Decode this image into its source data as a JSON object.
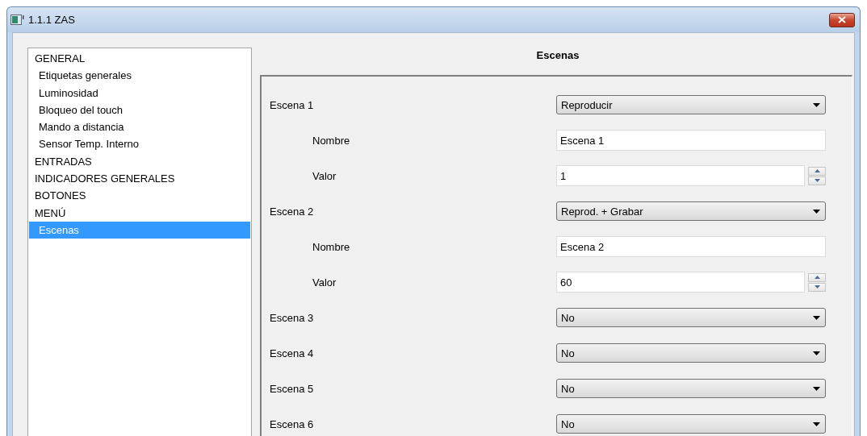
{
  "window": {
    "title": "1.1.1 ZAS"
  },
  "sidebar": {
    "items": [
      {
        "label": "GENERAL",
        "selected": false,
        "children": [
          {
            "label": "Etiquetas generales",
            "selected": false
          },
          {
            "label": "Luminosidad",
            "selected": false
          },
          {
            "label": "Bloqueo del touch",
            "selected": false
          },
          {
            "label": "Mando a distancia",
            "selected": false
          },
          {
            "label": "Sensor Temp. Interno",
            "selected": false
          }
        ]
      },
      {
        "label": "ENTRADAS",
        "selected": false
      },
      {
        "label": "INDICADORES GENERALES",
        "selected": false
      },
      {
        "label": "BOTONES",
        "selected": false
      },
      {
        "label": "MENÚ",
        "selected": false,
        "children": [
          {
            "label": "Escenas",
            "selected": true
          }
        ]
      }
    ]
  },
  "panel": {
    "title": "Escenas",
    "rows": [
      {
        "label": "Escena 1",
        "kind": "select",
        "value": "Reproducir",
        "children": [
          {
            "label": "Nombre",
            "kind": "text",
            "value": "Escena 1"
          },
          {
            "label": "Valor",
            "kind": "spin",
            "value": "1"
          }
        ]
      },
      {
        "label": "Escena 2",
        "kind": "select",
        "value": "Reprod. + Grabar",
        "children": [
          {
            "label": "Nombre",
            "kind": "text",
            "value": "Escena 2"
          },
          {
            "label": "Valor",
            "kind": "spin",
            "value": "60"
          }
        ]
      },
      {
        "label": "Escena 3",
        "kind": "select",
        "value": "No"
      },
      {
        "label": "Escena 4",
        "kind": "select",
        "value": "No"
      },
      {
        "label": "Escena 5",
        "kind": "select",
        "value": "No"
      },
      {
        "label": "Escena 6",
        "kind": "select",
        "value": "No"
      }
    ]
  }
}
